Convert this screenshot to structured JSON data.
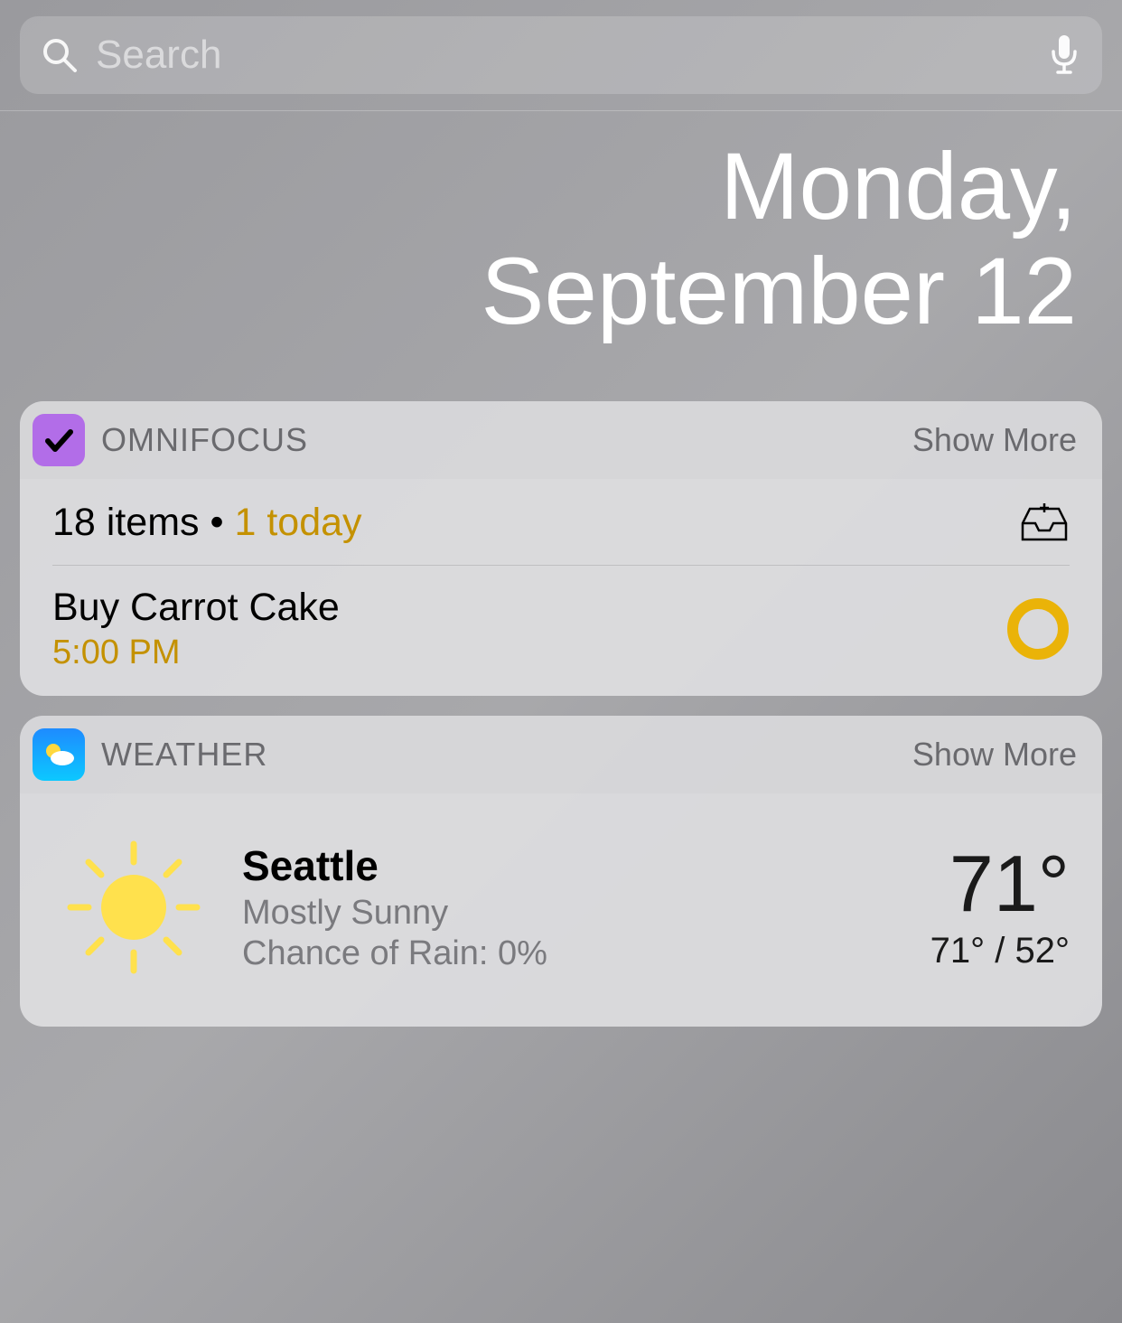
{
  "search": {
    "placeholder": "Search"
  },
  "date": {
    "line1": "Monday,",
    "line2": "September 12"
  },
  "omnifocus": {
    "title": "OMNIFOCUS",
    "show_more": "Show More",
    "summary_prefix": "18 items",
    "summary_dot": " • ",
    "summary_today": "1 today",
    "task_title": "Buy Carrot Cake",
    "task_time": "5:00 PM",
    "accent_color": "#c49100"
  },
  "weather": {
    "title": "WEATHER",
    "show_more": "Show More",
    "city": "Seattle",
    "condition": "Mostly Sunny",
    "rain": "Chance of Rain: 0%",
    "current_temp": "71°",
    "temp_range": "71° / 52°"
  }
}
